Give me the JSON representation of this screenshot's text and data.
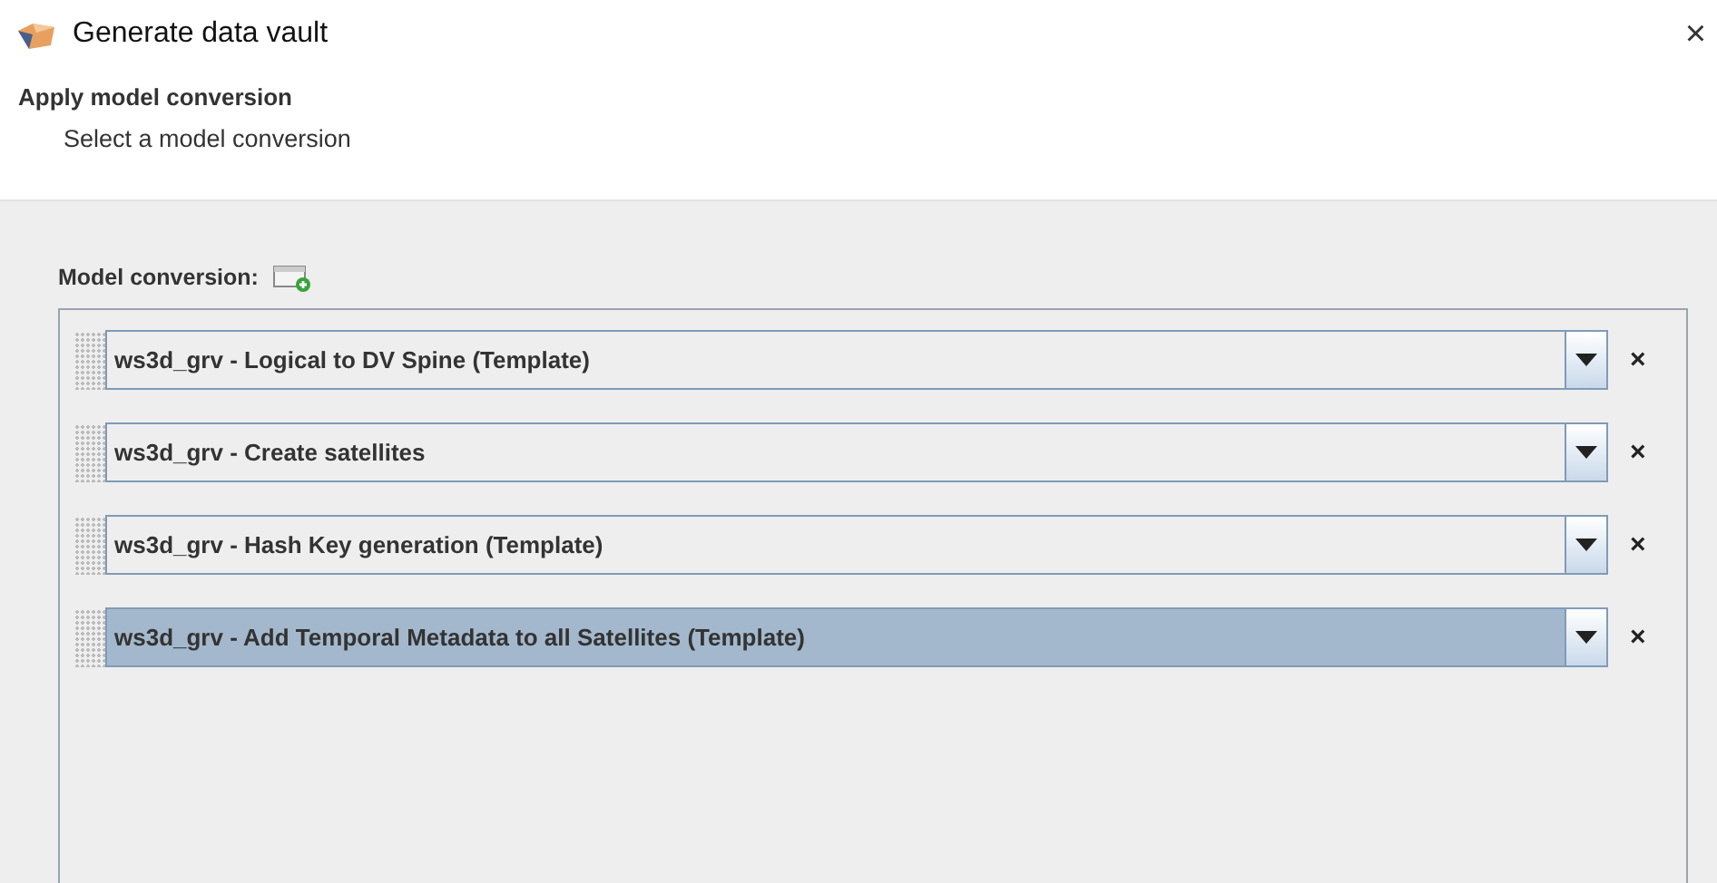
{
  "window": {
    "title": "Generate data vault",
    "close": "×"
  },
  "header": {
    "title": "Apply model conversion",
    "subtitle": "Select a model conversion"
  },
  "section": {
    "label": "Model conversion:"
  },
  "conversions": [
    {
      "value": "ws3d_grv - Logical to DV Spine (Template)",
      "selected": false,
      "remove": "×"
    },
    {
      "value": "ws3d_grv - Create satellites",
      "selected": false,
      "remove": "×"
    },
    {
      "value": "ws3d_grv - Hash Key generation (Template)",
      "selected": false,
      "remove": "×"
    },
    {
      "value": "ws3d_grv - Add Temporal Metadata to all Satellites (Template)",
      "selected": true,
      "remove": "×"
    }
  ]
}
